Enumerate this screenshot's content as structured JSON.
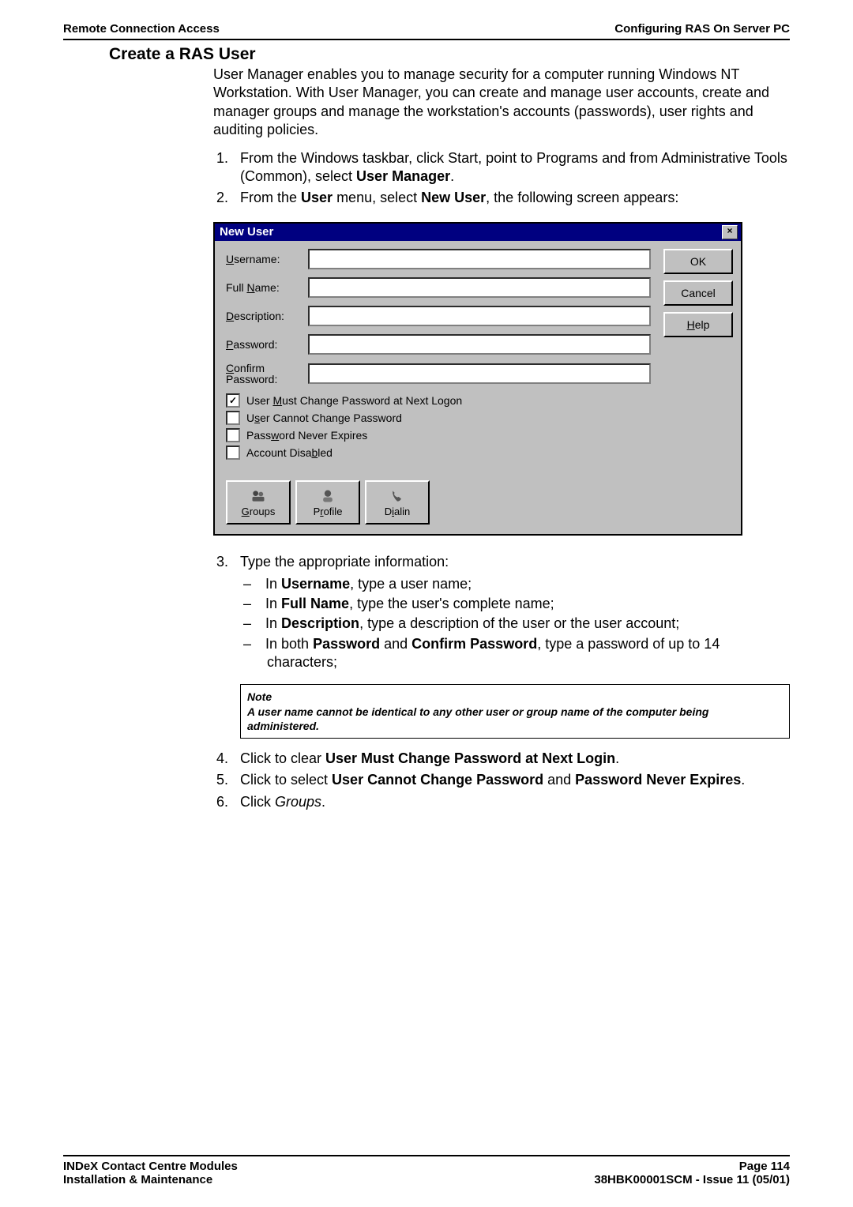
{
  "header": {
    "left": "Remote Connection Access",
    "right": "Configuring RAS On Server PC"
  },
  "section_title": "Create a RAS User",
  "intro": "User Manager enables you to manage security for a computer running Windows NT Workstation.  With User Manager, you can create and manage user accounts, create and manager groups and manage the workstation's accounts (passwords), user rights and auditing policies.",
  "step1_a": "From the Windows taskbar, click Start, point to Programs and from Administrative Tools (Common), select ",
  "step1_b": "User Manager",
  "step1_c": ".",
  "step2_a": "From the ",
  "step2_b": "User",
  "step2_c": " menu, select ",
  "step2_d": "New User",
  "step2_e": ", the following screen appears:",
  "dialog": {
    "title": "New User",
    "close": "×",
    "labels": {
      "username": "Username:",
      "fullname": "Full Name:",
      "description": "Description:",
      "password": "Password:",
      "confirm_a": "Confirm",
      "confirm_b": "Password:"
    },
    "checkboxes": {
      "must_change": "User Must Change Password at Next Logon",
      "cannot_change": "User Cannot Change Password",
      "never_expires": "Password Never Expires",
      "disabled": "Account Disabled"
    },
    "buttons": {
      "ok": "OK",
      "cancel": "Cancel",
      "help": "Help",
      "groups": "Groups",
      "profile": "Profile",
      "dialin": "Dialin"
    }
  },
  "step3": "Type the appropriate information:",
  "bullet1_a": "In ",
  "bullet1_b": "Username",
  "bullet1_c": ", type a user name;",
  "bullet2_a": "In ",
  "bullet2_b": "Full Name",
  "bullet2_c": ", type the user's complete name;",
  "bullet3_a": "In ",
  "bullet3_b": "Description",
  "bullet3_c": ", type a description of the user or the user account;",
  "bullet4_a": "In both ",
  "bullet4_b": "Password",
  "bullet4_c": " and ",
  "bullet4_d": "Confirm Password",
  "bullet4_e": ", type a password of up to 14 characters;",
  "note_title": "Note",
  "note_body": "A user name cannot be identical to any other user or group name of the computer being administered.",
  "step4_a": "Click to clear ",
  "step4_b": "User Must Change Password at Next Login",
  "step4_c": ".",
  "step5_a": "Click to select ",
  "step5_b": "User Cannot Change Password",
  "step5_c": " and ",
  "step5_d": "Password Never Expires",
  "step5_e": ".",
  "step6_a": "Click ",
  "step6_b": "Groups",
  "step6_c": ".",
  "footer": {
    "l1": "INDeX Contact Centre Modules",
    "l2": "Installation & Maintenance",
    "r1": "Page 114",
    "r2": "38HBK00001SCM - Issue 11 (05/01)"
  }
}
